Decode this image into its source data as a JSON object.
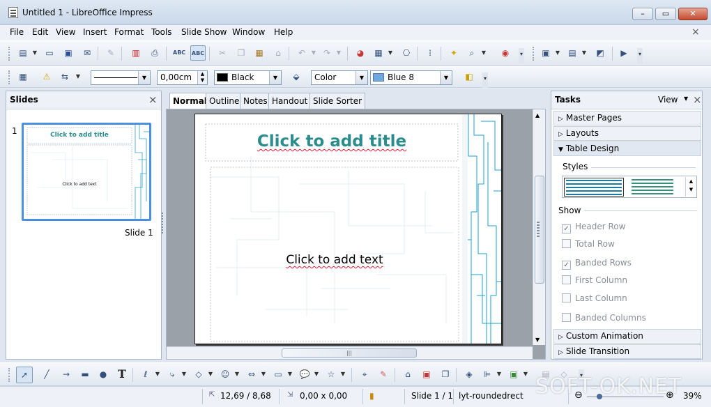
{
  "window": {
    "title": "Untitled 1 - LibreOffice Impress",
    "minimize": "–",
    "maximize": "▭",
    "close": "✕"
  },
  "menubar": {
    "items": [
      "File",
      "Edit",
      "View",
      "Insert",
      "Format",
      "Tools",
      "Slide Show",
      "Window",
      "Help"
    ],
    "doc_close": "×"
  },
  "line_toolbar": {
    "line_width": "0,00cm",
    "line_color": "Black",
    "area_style": "Color",
    "area_color": "Blue 8",
    "line_color_hex": "#000000",
    "area_color_hex": "#6fa8dc"
  },
  "slides_pane": {
    "title": "Slides",
    "close": "×",
    "slide_number": "1",
    "slide_label": "Slide 1",
    "thumb_title": "Click to add title",
    "thumb_text": "Click to add text"
  },
  "tabs": [
    "Normal",
    "Outline",
    "Notes",
    "Handout",
    "Slide Sorter"
  ],
  "slide": {
    "title_placeholder": "Click to add title",
    "content_placeholder": "Click to add text"
  },
  "tasks_pane": {
    "title": "Tasks",
    "view_label": "View",
    "close": "×",
    "sections": [
      "Master Pages",
      "Layouts",
      "Table Design",
      "Custom Animation",
      "Slide Transition"
    ],
    "styles_label": "Styles",
    "show_label": "Show",
    "options": [
      {
        "label": "Header Row",
        "checked": true
      },
      {
        "label": "Total Row",
        "checked": false
      },
      {
        "label": "Banded Rows",
        "checked": true
      },
      {
        "label": "First Column",
        "checked": false
      },
      {
        "label": "Last Column",
        "checked": false
      },
      {
        "label": "Banded Columns",
        "checked": false
      }
    ]
  },
  "statusbar": {
    "position": "12,69 / 8,68",
    "size": "0,00 x 0,00",
    "slide": "Slide 1 / 1",
    "layout": "lyt-roundedrect",
    "zoom": "39%"
  },
  "watermark": "SOFT-OK.NET"
}
